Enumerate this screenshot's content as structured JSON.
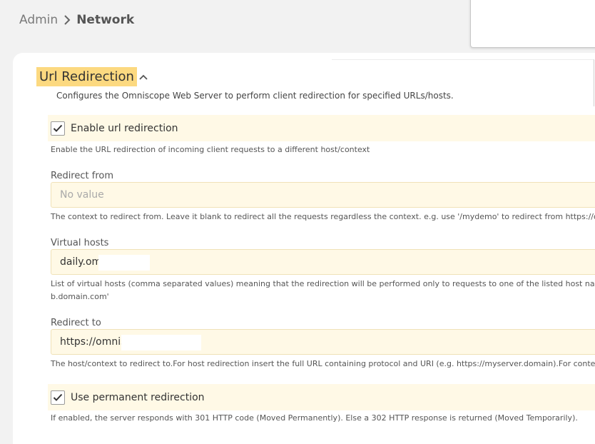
{
  "breadcrumb": {
    "root": "Admin",
    "current": "Network"
  },
  "section": {
    "title": "Url Redirection",
    "description": "Configures the Omniscope Web Server to perform client redirection for specified URLs/hosts."
  },
  "enable_redirection": {
    "label": "Enable url redirection",
    "checked": true,
    "help": "Enable the URL redirection of incoming client requests to a different host/context"
  },
  "redirect_from": {
    "label": "Redirect from",
    "value": "",
    "placeholder": "No value",
    "help": "The context to redirect from. Leave it blank to redirect all the requests regardless the context. e.g. use '/mydemo' to redirect from https://omniscop"
  },
  "virtual_hosts": {
    "label": "Virtual hosts",
    "value": "daily.omr",
    "help_line1": "List of virtual hosts (comma separated values) meaning that the redirection will be performed only to requests to one of the listed host names. If le",
    "help_line2": "b.domain.com'"
  },
  "redirect_to": {
    "label": "Redirect to",
    "value": "https://omnis",
    "help": "The host/context to redirect to.For host redirection insert the full URL containing protocol and URI (e.g. https://myserver.domain).For context redi"
  },
  "permanent_redirection": {
    "label": "Use permanent redirection",
    "checked": true,
    "help": "If enabled, the server responds with 301 HTTP code (Moved Permanently). Else a 302 HTTP response is returned (Moved Temporarily)."
  },
  "colors": {
    "title_highlight": "#fcd980",
    "row_background": "#fff9e6"
  }
}
